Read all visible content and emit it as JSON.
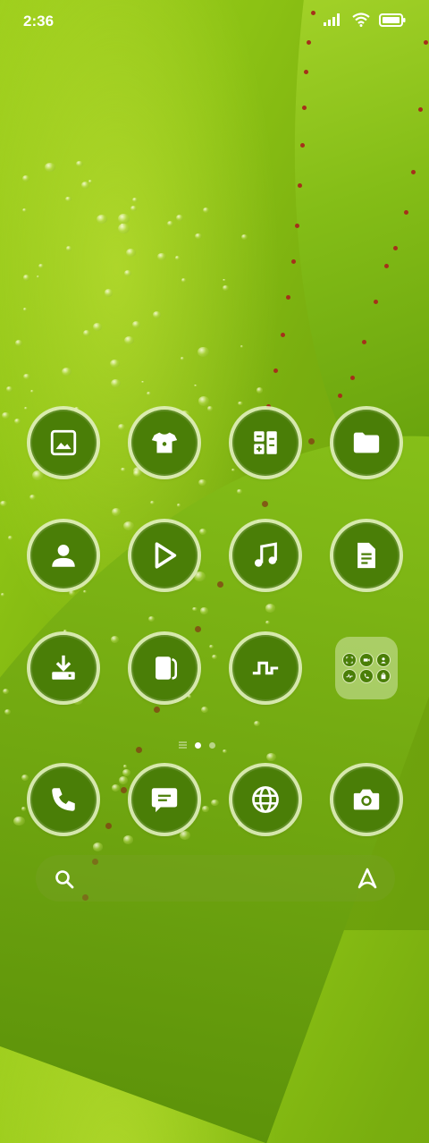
{
  "status_bar": {
    "time": "2:36",
    "signal_icon": "signal-bars-icon",
    "wifi_icon": "wifi-icon",
    "battery_icon": "battery-full-icon"
  },
  "home_screen": {
    "apps_row1": [
      "gallery-icon",
      "themes-tshirt-icon",
      "calculator-icon",
      "file-manager-folder-icon"
    ],
    "apps_row2": [
      "contacts-person-icon",
      "video-player-icon",
      "music-note-icon",
      "notes-document-icon"
    ],
    "apps_row3": [
      "downloads-icon",
      "wallet-cards-icon",
      "activity-pulse-icon",
      "app-folder"
    ],
    "folder_icons": [
      "scan-icon",
      "video-icon",
      "person-icon",
      "pulse-icon",
      "phone-icon",
      "store-icon"
    ],
    "page_indicator": {
      "pages": 2,
      "current": 1
    }
  },
  "dock": [
    "phone-icon",
    "messages-icon",
    "browser-globe-icon",
    "camera-icon"
  ],
  "search_bar": {
    "search_icon": "search-icon",
    "assistant_icon": "assistant-icon"
  },
  "colors": {
    "icon_fill": "#4a7e07",
    "icon_ring": "#e1f0be",
    "wallpaper": "#8cc214"
  }
}
